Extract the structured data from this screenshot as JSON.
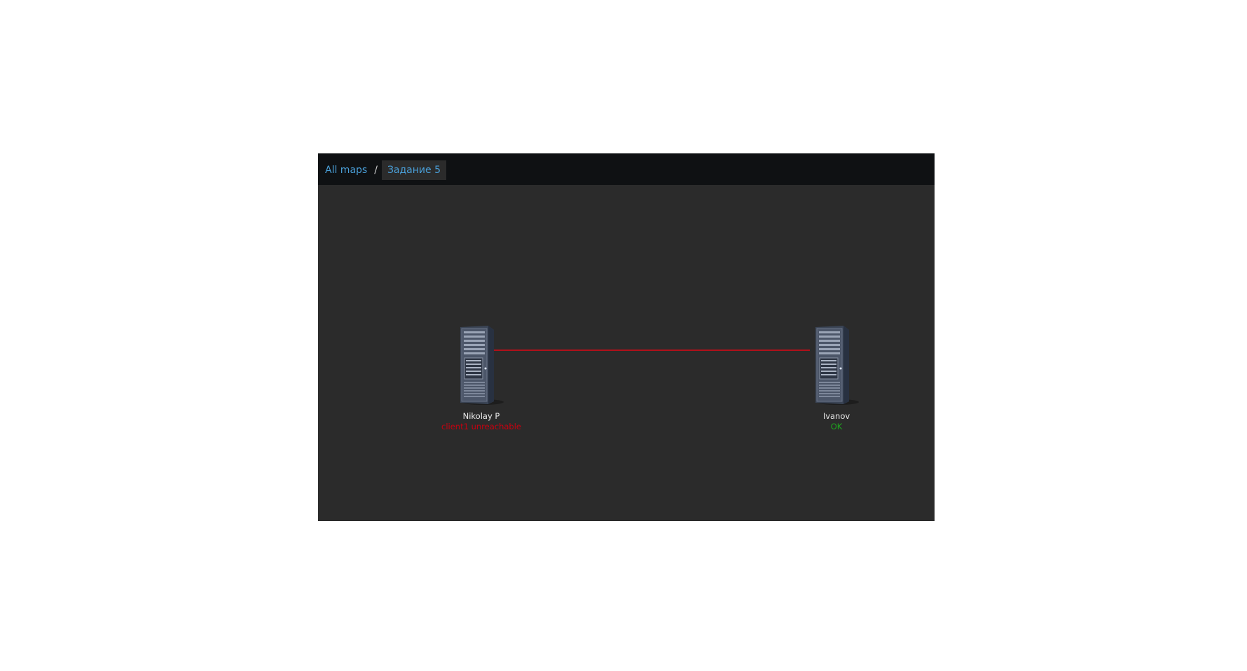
{
  "breadcrumb": {
    "all_maps": "All maps",
    "separator": "/",
    "current": "Задание 5"
  },
  "hosts": [
    {
      "name": "Nikolay P",
      "status": "client1 unreachable",
      "status_color": "#c8000f",
      "icon": "server-icon"
    },
    {
      "name": "Ivanov",
      "status": "OK",
      "status_color": "#1ea51e",
      "icon": "server-icon"
    }
  ],
  "link": {
    "color": "#b0101a"
  },
  "colors": {
    "header_bg": "#0f1113",
    "canvas_bg": "#2b2b2b",
    "link_text": "#4a9fd8"
  }
}
